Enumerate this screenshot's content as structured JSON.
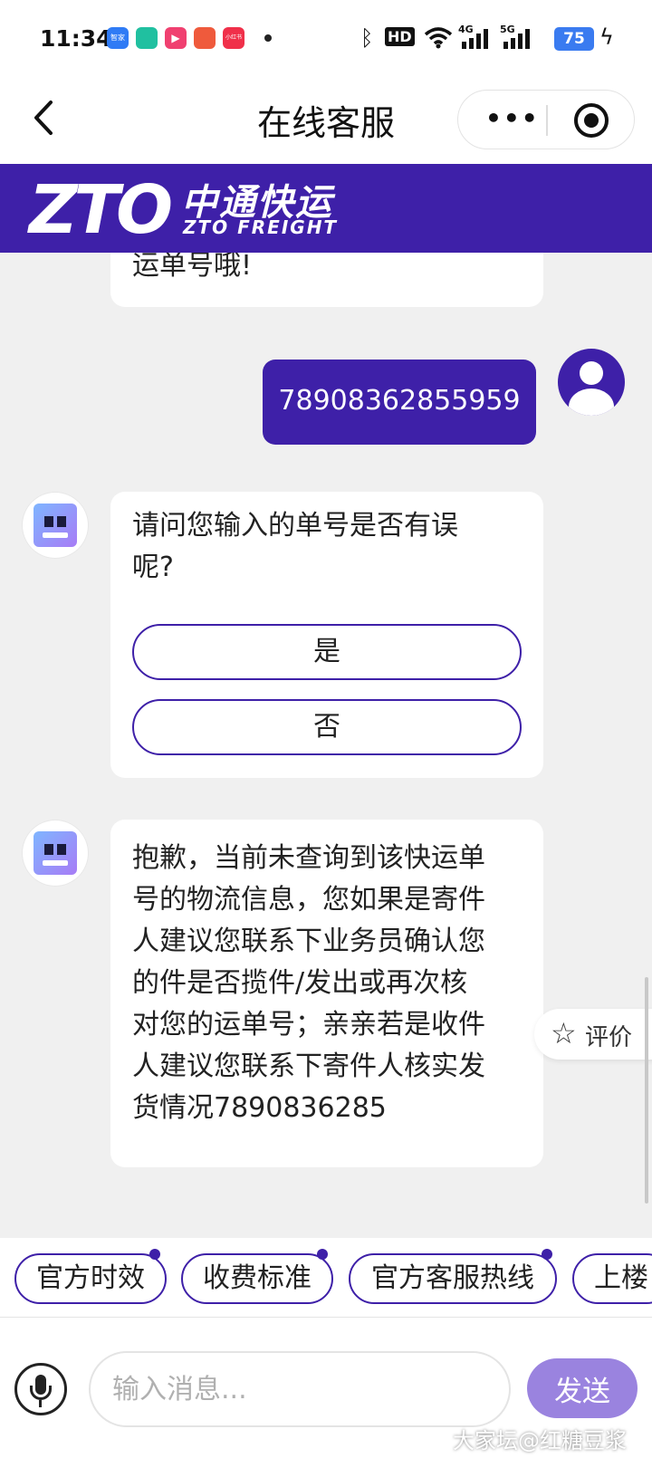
{
  "status_bar": {
    "time": "11:34",
    "app_icons": [
      {
        "name": "zhijia-icon",
        "label": "智家",
        "color": "#2f7bf5"
      },
      {
        "name": "mijia-icon",
        "label": "",
        "color": "#20c0a0"
      },
      {
        "name": "video-icon",
        "label": "▶",
        "color": "#f04070"
      },
      {
        "name": "shopping-icon",
        "label": "",
        "color": "#ef5a3c"
      },
      {
        "name": "xiaohongshu-icon",
        "label": "小红书",
        "color": "#f0304a"
      }
    ],
    "hd_label": "HD",
    "network_4g": "4G",
    "network_5g": "5G",
    "battery": "75"
  },
  "title_bar": {
    "title": "在线客服"
  },
  "brand": {
    "logo_text": "ZTO",
    "cn_name": "中通快运",
    "en_name": "ZTO FREIGHT",
    "color": "#3e20a8"
  },
  "chat": {
    "previous_bot_tail": "运单号哦!",
    "user_message": "78908362855959",
    "bot_question": [
      "请问您输入的单号是否有误",
      "呢?"
    ],
    "options": [
      "是",
      "否"
    ],
    "bot_reply_lines": [
      "抱歉，当前未查询到该快运单",
      "号的物流信息，您如果是寄件",
      "人建议您联系下业务员确认您",
      "的件是否揽件/发出或再次核",
      "对您的运单号；亲亲若是收件",
      "人建议您联系下寄件人核实发",
      "货情况7890836285"
    ],
    "rate_label": "评价"
  },
  "quick_chips": [
    "官方时效",
    "收费标准",
    "官方客服热线",
    "上楼"
  ],
  "input": {
    "placeholder": "输入消息...",
    "send_label": "发送"
  },
  "watermark": "大家坛@红糖豆浆"
}
